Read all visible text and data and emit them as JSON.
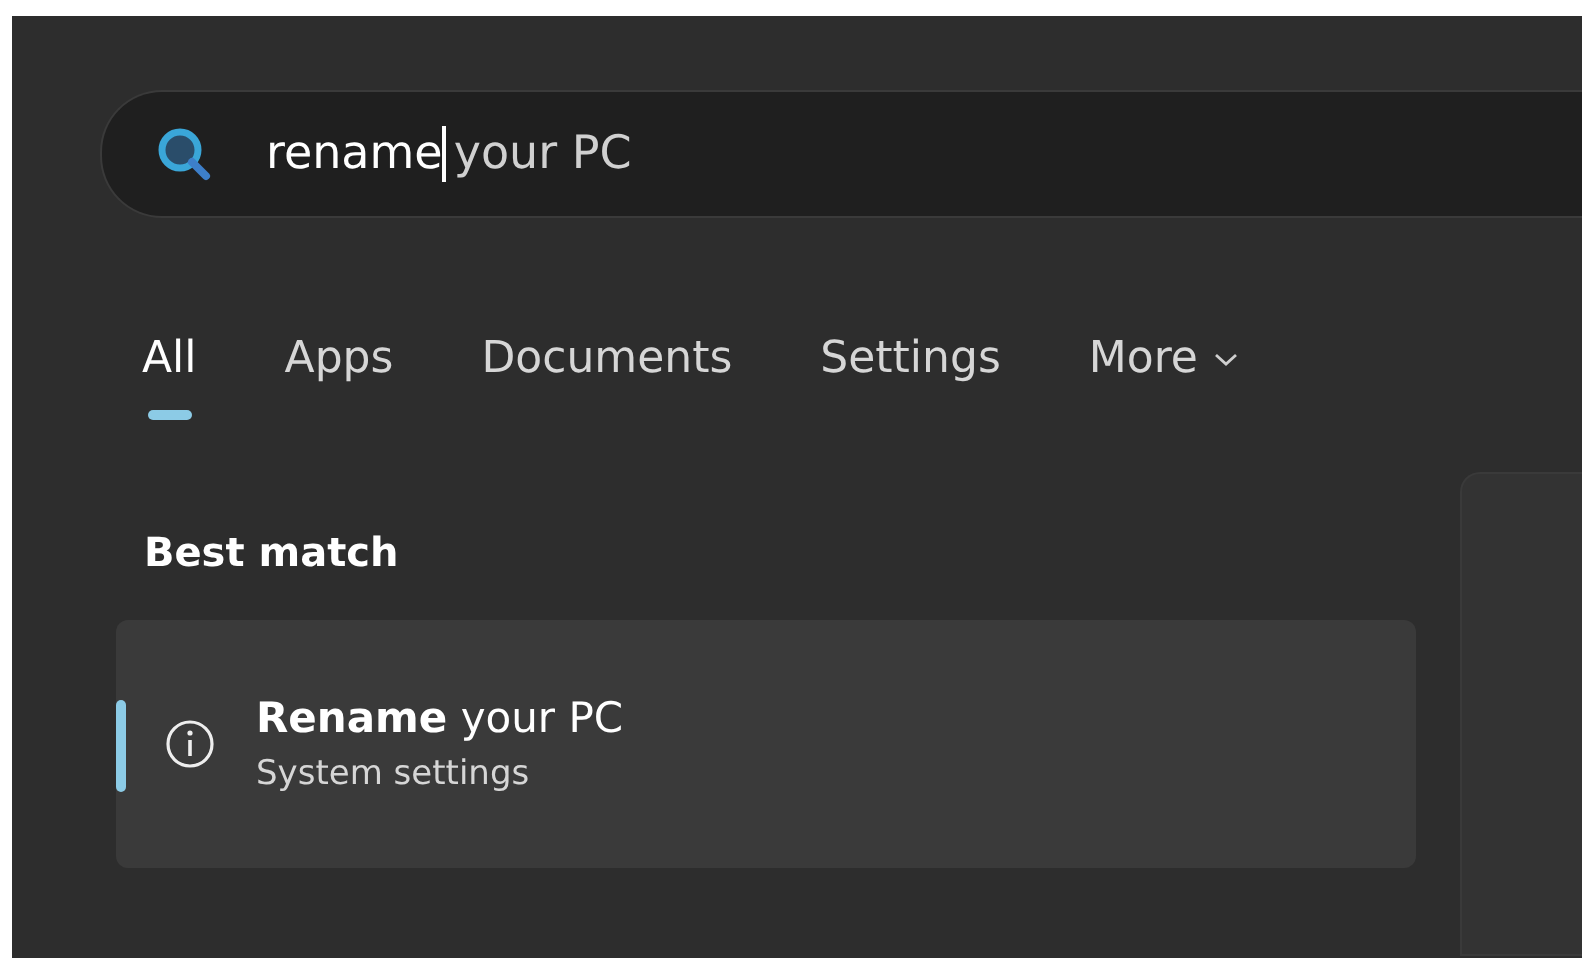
{
  "search": {
    "typed": "rename",
    "completion": "your PC"
  },
  "tabs": [
    {
      "label": "All",
      "selected": true
    },
    {
      "label": "Apps",
      "selected": false
    },
    {
      "label": "Documents",
      "selected": false
    },
    {
      "label": "Settings",
      "selected": false
    },
    {
      "label": "More",
      "selected": false,
      "dropdown": true
    }
  ],
  "section_title": "Best match",
  "best_match": {
    "title": "**Rename** your PC",
    "subtitle": "System settings",
    "selected": true
  }
}
